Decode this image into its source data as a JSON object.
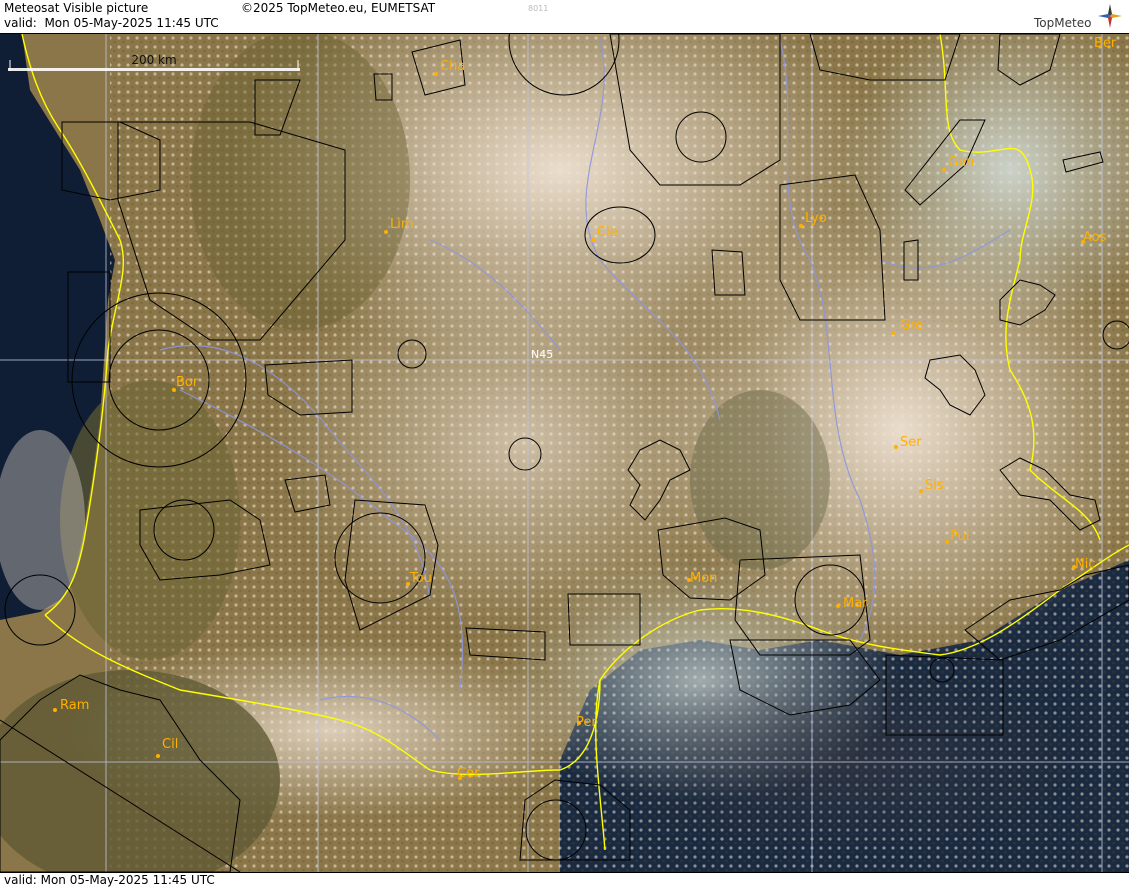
{
  "header": {
    "title": "Meteosat Visible picture",
    "valid_label": "valid:",
    "valid_value": "Mon  05-May-2025  11:45 UTC",
    "copyright": "©2025 TopMeteo.eu, EUMETSAT",
    "image_code": "8011",
    "logo_text": "TopMeteo"
  },
  "footer": {
    "valid_text": "valid:  Mon  05-May-2025  11:45 UTC"
  },
  "map": {
    "scale_bar_label": "200 km",
    "grid_label": "N45",
    "colors": {
      "sea": "#0f1e35",
      "land": "#6b6131",
      "cloud": "#e5d2bd",
      "border": "#ffff00",
      "rivers": "#8c96e0",
      "airspace": "#000000",
      "labels": "#ffb000"
    },
    "cities": [
      {
        "name": "Cha",
        "id": "cha"
      },
      {
        "name": "Lim",
        "id": "lim"
      },
      {
        "name": "Cle",
        "id": "cle"
      },
      {
        "name": "Lyo",
        "id": "lyo"
      },
      {
        "name": "Gen",
        "id": "gen"
      },
      {
        "name": "Ber",
        "id": "ber"
      },
      {
        "name": "Aos",
        "id": "aos"
      },
      {
        "name": "Gre",
        "id": "gre"
      },
      {
        "name": "Bor",
        "id": "bor"
      },
      {
        "name": "Ser",
        "id": "ser"
      },
      {
        "name": "Sis",
        "id": "sis"
      },
      {
        "name": "Pui",
        "id": "pui"
      },
      {
        "name": "Tou",
        "id": "tou"
      },
      {
        "name": "Mon",
        "id": "mon"
      },
      {
        "name": "Mar",
        "id": "mar"
      },
      {
        "name": "Nic",
        "id": "nic"
      },
      {
        "name": "Ram",
        "id": "ram"
      },
      {
        "name": "Cil",
        "id": "cil"
      },
      {
        "name": "Per",
        "id": "per"
      },
      {
        "name": "Cer",
        "id": "cer"
      }
    ]
  }
}
